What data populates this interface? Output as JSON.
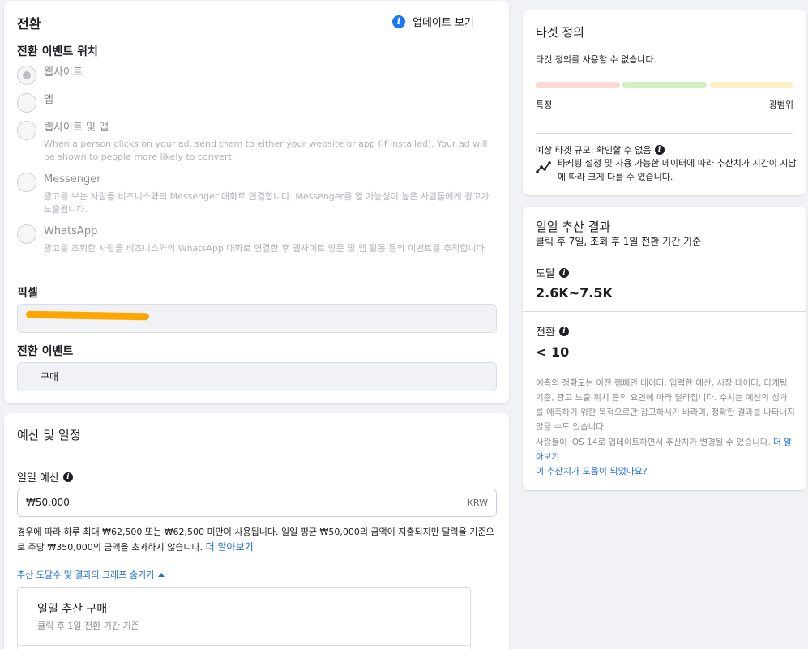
{
  "conversion_card": {
    "title": "전환",
    "update_link": "업데이트 보기",
    "location_heading": "전환 이벤트 위치",
    "options": [
      {
        "label": "웹사이트",
        "selected": true,
        "desc": ""
      },
      {
        "label": "앱",
        "selected": false,
        "desc": ""
      },
      {
        "label": "웹사이트 및 앱",
        "selected": false,
        "desc": "When a person clicks on your ad, send them to either your website or app (if installed). Your ad will be shown to people more likely to convert."
      },
      {
        "label": "Messenger",
        "selected": false,
        "desc": "광고를 보는 사람을 비즈니스와의 Messenger 대화로 연결합니다. Messenger를 열 가능성이 높은 사람들에게 광고가 노출됩니다."
      },
      {
        "label": "WhatsApp",
        "selected": false,
        "desc": "광고를 조회한 사람을 비즈니스와의 WhatsApp 대화로 연결한 후 웹사이트 방문 및 앱 활동 등의 이벤트를 추적합니다"
      }
    ],
    "pixel_heading": "픽셀",
    "pixel_value": "",
    "event_heading": "전환 이벤트",
    "event_value": "구매"
  },
  "budget_card": {
    "title": "예산 및 일정",
    "daily_budget_label": "일일 예산",
    "budget_value": "₩50,000",
    "currency": "KRW",
    "note": "경우에 따라 하루 최대 ₩62,500 또는 ₩62,500 미만이 사용됩니다. 일일 평균 ₩50,000의 금액이 지출되지만 달력을 기준으로 주당 ₩350,000의 금액을 초과하지 않습니다.",
    "note_link": "더 알아보기",
    "toggle_graph": "추산 도달수 및 결과의 그래프 숨기기",
    "estimate_box": {
      "title": "일일 추산 구매",
      "subtitle": "클릭 후 1일 전환 기간 기준"
    }
  },
  "target_card": {
    "title": "타겟 정의",
    "message": "타겟 정의를 사용할 수 없습니다.",
    "left_label": "특정",
    "right_label": "광범위",
    "size_label": "예상 타겟 규모: 확인할 수 없음",
    "size_note": "타케팅 설정 및 사용 가능한 데이터에 따라 추산치가 시간이 지남에 따라 크게 다를 수 있습니다.",
    "bar_colors": [
      "#fcd9d6",
      "#d2efc4",
      "#fdf0c7"
    ]
  },
  "results_card": {
    "title": "일일 추산 결과",
    "subtitle": "클릭 후 7일, 조회 후 1일 전환 기간 기준",
    "reach_label": "도달",
    "reach_value": "2.6K~7.5K",
    "conv_label": "전환",
    "conv_value": "< 10",
    "disclaimer": "예측의 정확도는 이전 캠페인 데이터, 입력한 예산, 시장 데이터, 타게팅 기준, 광고 노출 위치 등의 요인에 따라 달라집니다. 수치는 예산의 성과를 예측하기 위한 목적으로만 참고하시기 바라며, 정확한 결과를 나타내지 않을 수도 있습니다.",
    "ios_note": "사람들이 iOS 14로 업데이트하면서 추산치가 변경될 수 있습니다.",
    "ios_link": "더 알아보기",
    "feedback_link": "이 추산치가 도움이 되었나요?"
  }
}
